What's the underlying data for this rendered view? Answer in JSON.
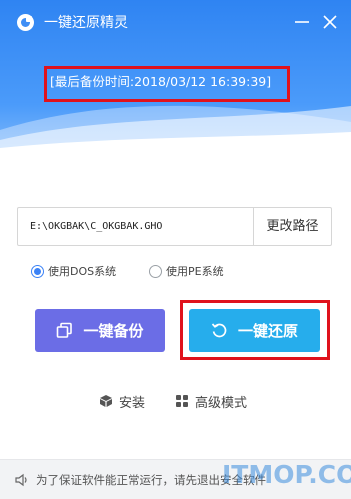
{
  "window": {
    "title": "一键还原精灵",
    "min_icon": "minimize-icon",
    "close_icon": "close-icon"
  },
  "header": {
    "last_backup_text": "[最后备份时间:2018/03/12 16:39:39]"
  },
  "path": {
    "value": "E:\\OKGBAK\\C_OKGBAK.GHO",
    "change_button": "更改路径"
  },
  "mode": {
    "options": [
      {
        "label": "使用DOS系统",
        "checked": true
      },
      {
        "label": "使用PE系统",
        "checked": false
      }
    ]
  },
  "actions": {
    "backup_label": "一键备份",
    "restore_label": "一键还原"
  },
  "links": {
    "install_label": "安装",
    "advanced_label": "高级模式"
  },
  "footer": {
    "notice": "为了保证软件能正常运行，请先退出安全软件"
  },
  "watermark": "ITMOP.COM",
  "colors": {
    "header_blue": "#3f8ef5",
    "backup_button": "#6b6de6",
    "restore_button": "#26adec",
    "highlight_red": "#e0121c"
  }
}
